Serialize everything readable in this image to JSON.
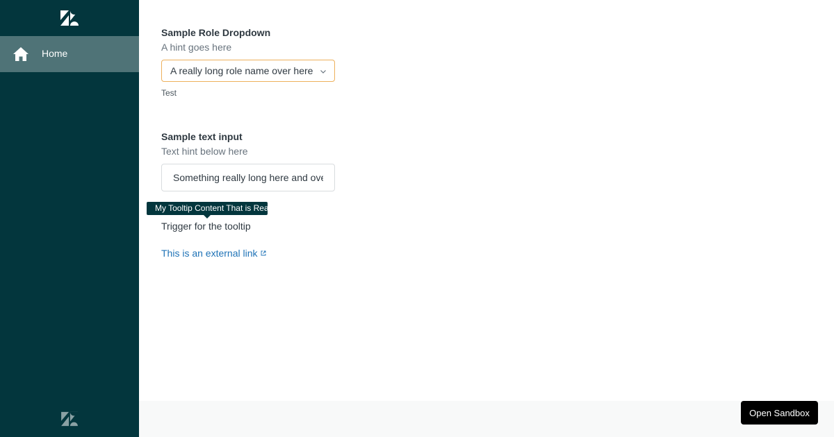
{
  "sidebar": {
    "logo_icon": "zendesk-logo",
    "items": [
      {
        "label": "Home",
        "icon": "home-icon",
        "active": true
      }
    ],
    "bottom_logo_icon": "zendesk-logo"
  },
  "role_dropdown": {
    "label": "Sample Role Dropdown",
    "hint": "A hint goes here",
    "value": "A really long role name over here",
    "message": "Test",
    "icon": "chevron-down-icon"
  },
  "text_input": {
    "label": "Sample text input",
    "hint": "Text hint below here",
    "value": "Something really long here and over"
  },
  "tooltip": {
    "content": "My Tooltip Content That is Really Long",
    "trigger_label": "Trigger for the tooltip"
  },
  "external_link": {
    "label": "This is an external link",
    "icon": "external-link-icon"
  },
  "footer": {
    "sandbox_button": "Open Sandbox"
  },
  "colors": {
    "sidebar_bg": "#03363d",
    "active_item_bg": "#4f7377",
    "link": "#1f73b7",
    "focus_border": "#edb05b"
  }
}
